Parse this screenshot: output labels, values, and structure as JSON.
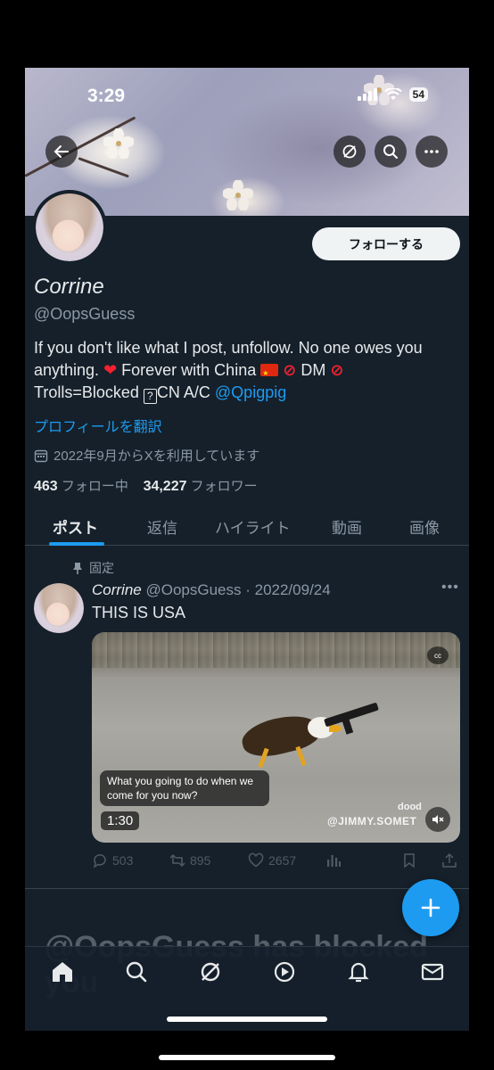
{
  "status_bar": {
    "time": "3:29",
    "battery": "54"
  },
  "profile": {
    "follow_label": "フォローする",
    "display_name": "Corrine",
    "handle": "@OopsGuess",
    "bio": {
      "line1": "If you don't like what I post, unfollow. No one owes you",
      "line2a": "anything. ",
      "line2b": " Forever with China ",
      "line2c": " DM ",
      "line3a": "Trolls=Blocked ",
      "line3b": "CN A/C ",
      "mention": "@Qpigpig"
    },
    "translate_label": "プロフィールを翻訳",
    "joined": "2022年9月からXを利用しています",
    "following_count": "463",
    "following_label": "フォロー中",
    "followers_count": "34,227",
    "followers_label": "フォロワー"
  },
  "tabs": [
    {
      "label": "ポスト",
      "active": true
    },
    {
      "label": "返信"
    },
    {
      "label": "ハイライト"
    },
    {
      "label": "動画"
    },
    {
      "label": "画像"
    }
  ],
  "tweet": {
    "pinned_label": "固定",
    "name": "Corrine",
    "handle_date": "@OopsGuess · 2022/09/24",
    "text": "THIS IS USA",
    "video": {
      "caption": "What you going to do when we come for you now?",
      "duration": "1:30",
      "cc": "cc",
      "watermark": "@JIMMY.SOMET",
      "watermark2": "dood"
    },
    "replies": "503",
    "reposts": "895",
    "likes": "2657"
  },
  "blocked_message": "@OopsGuess has blocked you",
  "colors": {
    "accent": "#1d9bf0",
    "background": "#15202b",
    "muted": "#8b98a5"
  },
  "icons": [
    "back-arrow-icon",
    "grok-icon",
    "search-icon",
    "more-icon",
    "pin-icon",
    "calendar-icon",
    "reply-icon",
    "repost-icon",
    "like-icon",
    "views-icon",
    "bookmark-icon",
    "share-icon",
    "compose-plus-icon",
    "home-icon",
    "explore-icon",
    "spaces-icon",
    "notifications-icon",
    "messages-icon"
  ]
}
